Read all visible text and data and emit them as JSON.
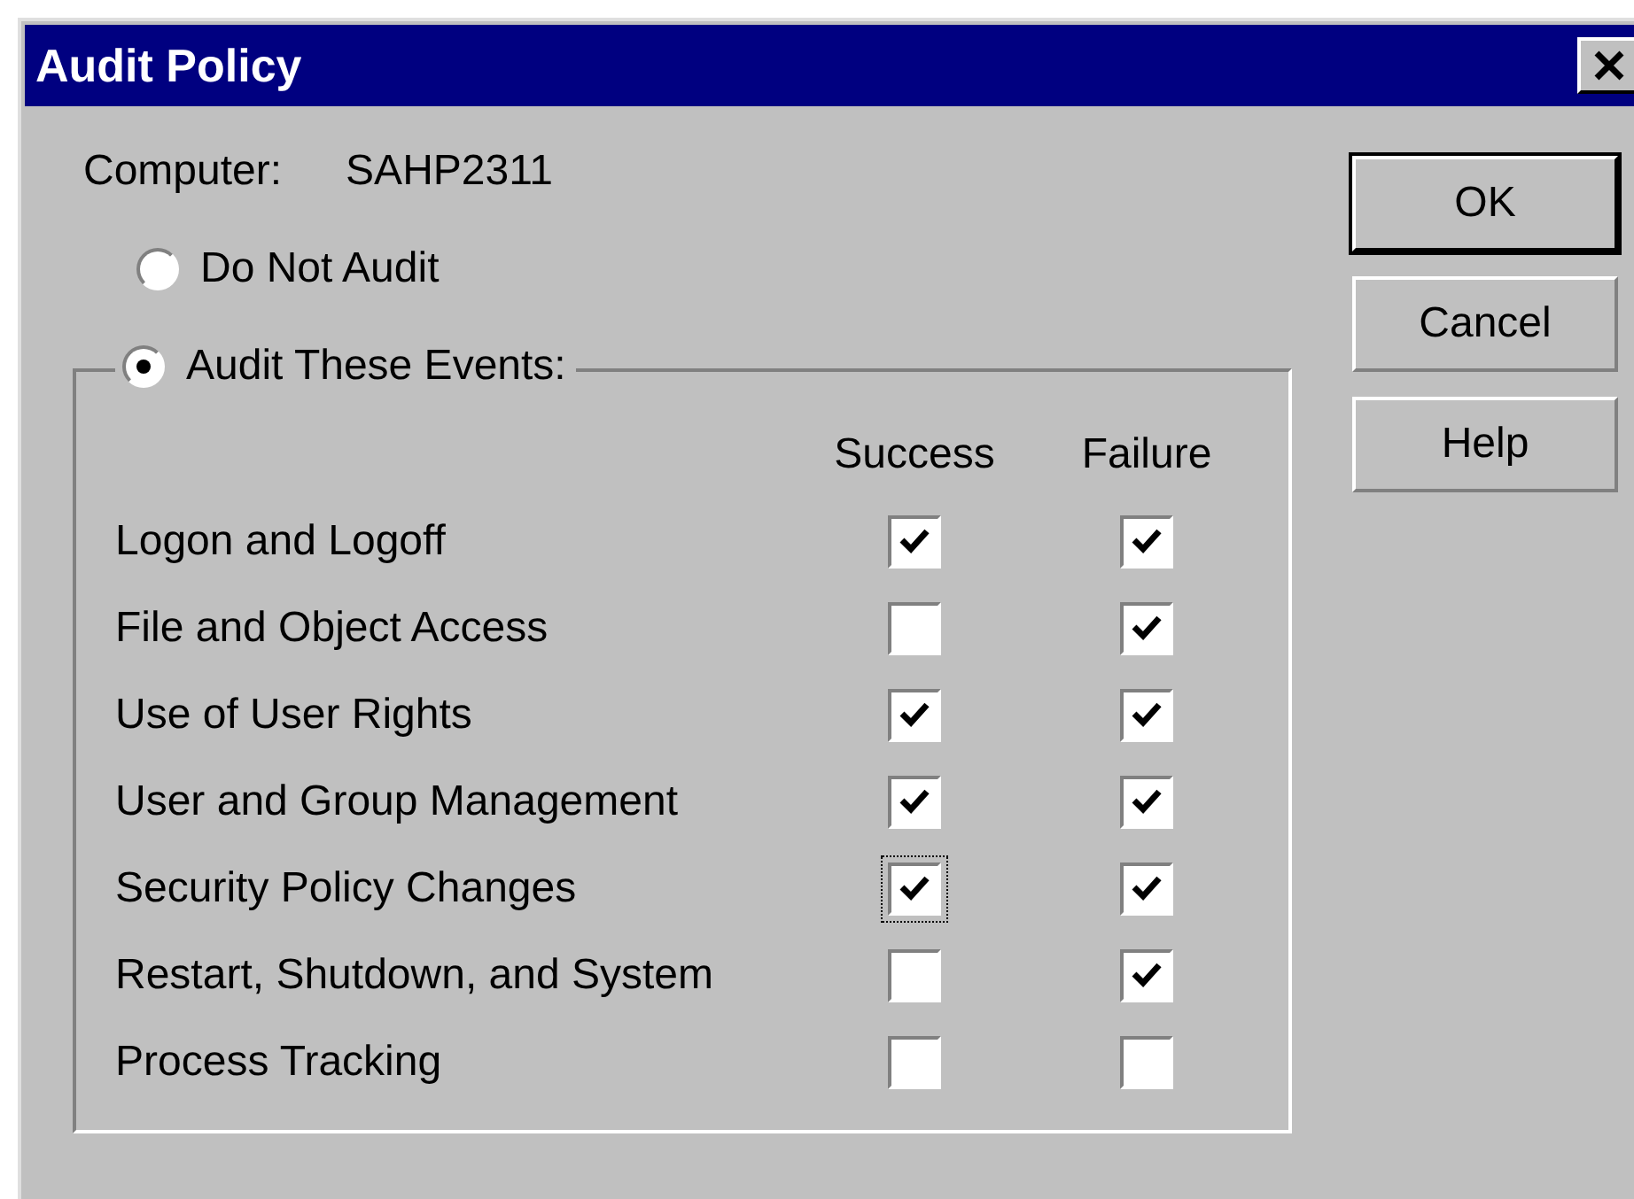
{
  "window": {
    "title": "Audit Policy"
  },
  "computer": {
    "label": "Computer:",
    "value": "SAHP2311"
  },
  "options": [
    {
      "label": "Do Not Audit",
      "selected": false
    },
    {
      "label": "Audit These Events:",
      "selected": true
    }
  ],
  "columns": [
    "Success",
    "Failure"
  ],
  "events": [
    {
      "label": "Logon and Logoff",
      "success": true,
      "failure": true,
      "success_focused": false
    },
    {
      "label": "File and Object Access",
      "success": false,
      "failure": true,
      "success_focused": false
    },
    {
      "label": "Use of User Rights",
      "success": true,
      "failure": true,
      "success_focused": false
    },
    {
      "label": "User and Group Management",
      "success": true,
      "failure": true,
      "success_focused": false
    },
    {
      "label": "Security Policy Changes",
      "success": true,
      "failure": true,
      "success_focused": true
    },
    {
      "label": "Restart, Shutdown, and System",
      "success": false,
      "failure": true,
      "success_focused": false
    },
    {
      "label": "Process Tracking",
      "success": false,
      "failure": false,
      "success_focused": false
    }
  ],
  "buttons": [
    {
      "label": "OK",
      "default": true
    },
    {
      "label": "Cancel",
      "default": false
    },
    {
      "label": "Help",
      "default": false
    }
  ]
}
